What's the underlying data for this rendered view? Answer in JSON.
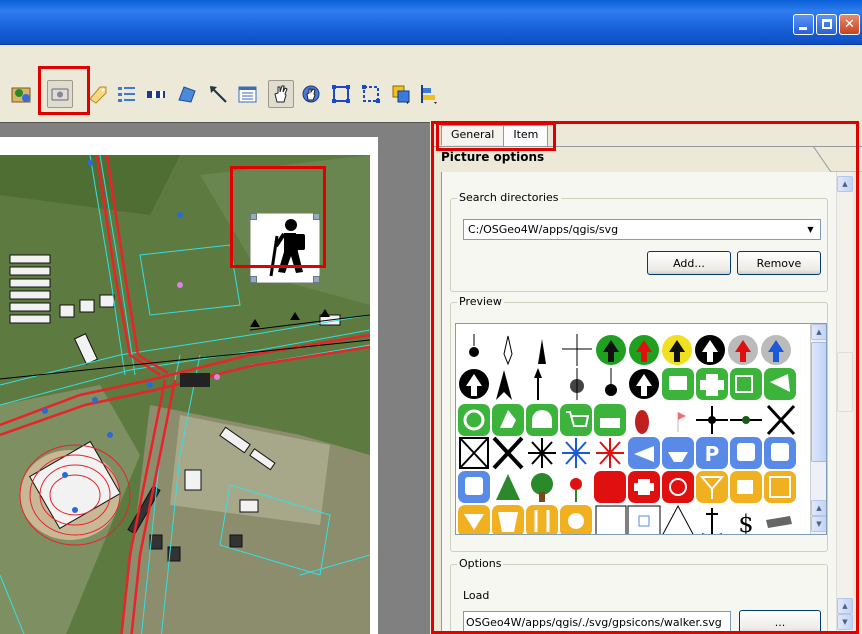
{
  "window": {
    "controls": [
      "minimize-button",
      "maximize-button",
      "close-button"
    ]
  },
  "toolbar": {
    "icons": [
      "add-map-icon",
      "add-image-icon",
      "add-label-icon",
      "add-legend-icon",
      "add-scalebar-icon",
      "add-shape-icon",
      "add-arrow-icon",
      "add-table-icon",
      "select-move-icon",
      "move-content-icon",
      "group-icon",
      "ungroup-icon",
      "raise-icon",
      "align-icon"
    ]
  },
  "tabs": {
    "general": "General",
    "item": "Item"
  },
  "panel": {
    "title": "Picture options"
  },
  "search": {
    "group_title": "Search directories",
    "directory": "C:/OSGeo4W/apps/qgis/svg",
    "add_label": "Add...",
    "remove_label": "Remove"
  },
  "preview": {
    "group_title": "Preview",
    "symbols": [
      "$"
    ]
  },
  "options": {
    "group_title": "Options",
    "load_label": "Load",
    "path": "OSGeo4W/apps/qgis/./svg/gpsicons/walker.svg",
    "browse_label": "..."
  },
  "colors": {
    "highlight": "#e00000",
    "map_green": "#5f7a42",
    "road_red": "#e8232a",
    "cyan": "#33e0e0"
  }
}
